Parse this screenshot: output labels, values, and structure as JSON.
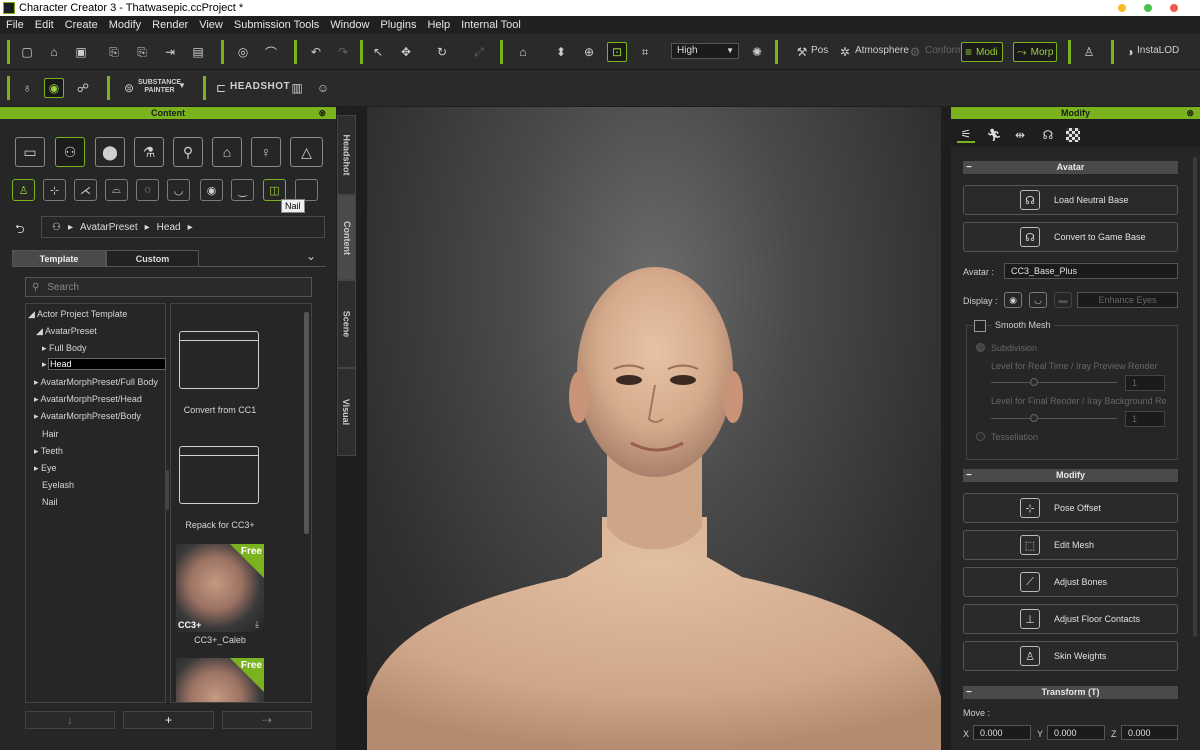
{
  "window": {
    "title": "Character Creator 3 - Thatwasepic.ccProject *"
  },
  "menu": [
    "File",
    "Edit",
    "Create",
    "Modify",
    "Render",
    "View",
    "Submission Tools",
    "Window",
    "Plugins",
    "Help",
    "Internal Tool"
  ],
  "toolbar": {
    "quality": "High",
    "pos_label": "Pos",
    "atmosphere_label": "Atmosphere",
    "conform_label": "Conform",
    "modi_label": "Modi",
    "morph_label": "Morp",
    "instalod_label": "InstaLOD",
    "substance_label_1": "SUBSTANCE",
    "substance_label_2": "PAINTER",
    "headshot_label": "HEADSHOT"
  },
  "content": {
    "title": "Content",
    "tooltip": "Nail",
    "breadcrumb": [
      "AvatarPreset",
      "Head"
    ],
    "tabs": [
      "Template",
      "Custom"
    ],
    "search_placeholder": "Search",
    "tree": [
      "Actor Project Template",
      "AvatarPreset",
      "Full Body",
      "Head",
      "AvatarMorphPreset/Full Body",
      "AvatarMorphPreset/Head",
      "AvatarMorphPreset/Body",
      "Hair",
      "Teeth",
      "Eye",
      "Eyelash",
      "Nail"
    ],
    "items": [
      {
        "label": "Convert from CC1"
      },
      {
        "label": "Repack for CC3+"
      },
      {
        "label": "CC3+_Caleb",
        "badge": "Free",
        "brand": "CC3+"
      },
      {
        "label": "",
        "badge": "Free"
      }
    ]
  },
  "side_tabs": [
    "Headshot",
    "Content",
    "Scene",
    "Visual"
  ],
  "modify": {
    "title": "Modify",
    "avatar_section": "Avatar",
    "load_neutral_base": "Load Neutral Base",
    "convert_game_base": "Convert to Game Base",
    "avatar_label": "Avatar :",
    "avatar_value": "CC3_Base_Plus",
    "display_label": "Display :",
    "enhance_eyes": "Enhance Eyes",
    "smooth_mesh": "Smooth Mesh",
    "subdivision": "Subdivision",
    "level_realtime": "Level for Real Time / Iray Preview Render",
    "level_realtime_value": "1",
    "level_final": "Level for Final Render / Iray Background Render",
    "level_final_value": "1",
    "tessellation": "Tessellation",
    "modify_section": "Modify",
    "pose_offset": "Pose Offset",
    "edit_mesh": "Edit Mesh",
    "adjust_bones": "Adjust Bones",
    "adjust_floor": "Adjust Floor Contacts",
    "skin_weights": "Skin Weights",
    "transform_section": "Transform  (T)",
    "move_label": "Move :",
    "x_label": "X",
    "x_value": "0.000",
    "y_label": "Y",
    "y_value": "0.000",
    "z_label": "Z",
    "z_value": "0.000"
  },
  "colors": {
    "accent": "#7bb31f",
    "panel": "#262626",
    "background": "#1e1e1e"
  }
}
